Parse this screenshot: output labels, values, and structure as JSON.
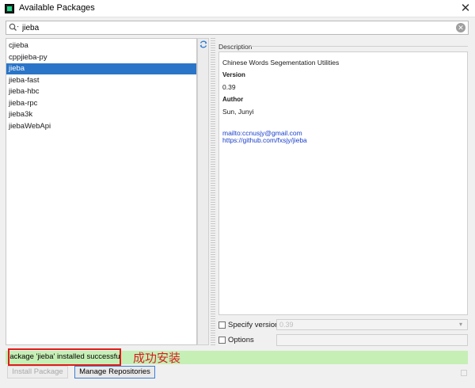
{
  "window": {
    "title": "Available Packages",
    "close_glyph": "✕"
  },
  "search": {
    "value": "jieba",
    "icon": "search-icon",
    "clear_glyph": "✕"
  },
  "packages": [
    "cjieba",
    "cppjieba-py",
    "jieba",
    "jieba-fast",
    "jieba-hbc",
    "jieba-rpc",
    "jieba3k",
    "jiebaWebApi"
  ],
  "selected_package": "jieba",
  "description": {
    "label": "Description",
    "summary": "Chinese Words Segementation Utilities",
    "version_label": "Version",
    "version": "0.39",
    "author_label": "Author",
    "author": "Sun, Junyi",
    "email_link": "mailto:ccnusjy@gmail.com",
    "homepage_link": "https://github.com/fxsjy/jieba"
  },
  "options": {
    "specify_version_label": "Specify version",
    "specify_version_value": "0.39",
    "options_label": "Options"
  },
  "status": {
    "message": "Package 'jieba' installed successfully",
    "annotation": "成功安装"
  },
  "buttons": {
    "install": "Install Package",
    "manage": "Manage Repositories"
  },
  "colors": {
    "selection": "#2a75c8",
    "status_bg": "#c6efb5",
    "annotation": "#d81e1e",
    "link": "#1a3ec9"
  }
}
